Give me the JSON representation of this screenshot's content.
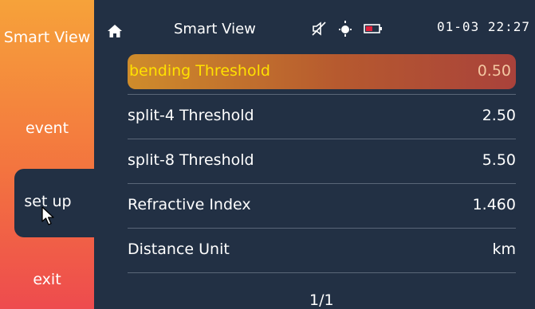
{
  "header": {
    "title": "Smart View",
    "clock": "01-03 22:27"
  },
  "sidebar": {
    "items": [
      {
        "label": "Smart View"
      },
      {
        "label": "event"
      },
      {
        "label": "set up"
      },
      {
        "label": "exit"
      }
    ],
    "active": "set up"
  },
  "settings": {
    "rows": [
      {
        "label": "bending Threshold",
        "value": "0.50"
      },
      {
        "label": "split-4 Threshold",
        "value": "2.50"
      },
      {
        "label": "split-8 Threshold",
        "value": "5.50"
      },
      {
        "label": "Refractive Index",
        "value": "1.460"
      },
      {
        "label": "Distance Unit",
        "value": "km"
      }
    ],
    "page": "1/1"
  },
  "icons": {
    "home": "home-icon",
    "mute": "speaker-muted-icon",
    "sun": "brightness-icon",
    "battery": "battery-low-icon",
    "cursor": "mouse-pointer-icon"
  },
  "colors": {
    "accent": "#ffe100",
    "sidebar_top": "#f6a23a",
    "sidebar_bottom": "#ee4b4e",
    "background": "#223044",
    "battery": "#e0223c"
  }
}
